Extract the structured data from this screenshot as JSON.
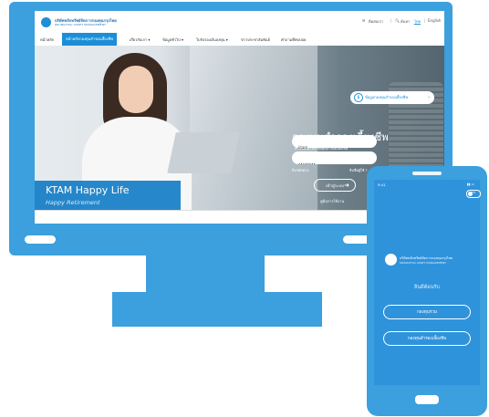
{
  "header": {
    "logo_th": "บริษัทหลักทรัพย์จัดการกองทุนกรุงไทย",
    "logo_en": "KRUNGTHAI ASSET MANAGEMENT",
    "contact": "ติดต่อเรา",
    "search": "ค้นหา",
    "lang_th": "ไทย",
    "lang_en": "English"
  },
  "nav": {
    "items": [
      "หน้าหลัก",
      "หน้าหลักกองทุนสำรองเลี้ยงชีพ",
      "เกี่ยวกับเรา",
      "ข้อมูลทั่วไป",
      "ใบรับรองเงินลงทุน",
      "ข่าวประชาสัมพันธ์",
      "คำถามที่พบบ่อย"
    ]
  },
  "hero": {
    "title": "KTAM Happy Life",
    "subtitle": "Happy Retirement",
    "fund_info_link": "ข้อมูลกองทุนสำรองเลี้ยงชีพ"
  },
  "login": {
    "title": "กองทุนสำรองเลี้ยงชีพ",
    "subtitle": "สำหรับสมาชิกกองทุนสำรองเลี้ยงชีพ",
    "username_value": "ktam",
    "password_value": "••••••••",
    "forgot_username": "ลืมรหัสผ่าน",
    "forgot_password": "ลืมชื่อผู้ใช้ ?",
    "button": "เข้าสู่ระบบ",
    "guide": "คู่มือการใช้งาน"
  },
  "phone": {
    "time": "9:41",
    "toggle_label": "TH",
    "logo_th": "บริษัทหลักทรัพย์จัดการกองทุนกรุงไทย",
    "logo_en": "KRUNGTHAI ASSET MANAGEMENT",
    "welcome": "ยินดีต้อนรับ",
    "button_fund": "กองทุนรวม",
    "button_pvd": "กองทุนสำรองเลี้ยงชีพ"
  },
  "colors": {
    "device": "#3ba0dd",
    "accent": "#1b8ed8",
    "phone_screen": "#2f93dc"
  }
}
